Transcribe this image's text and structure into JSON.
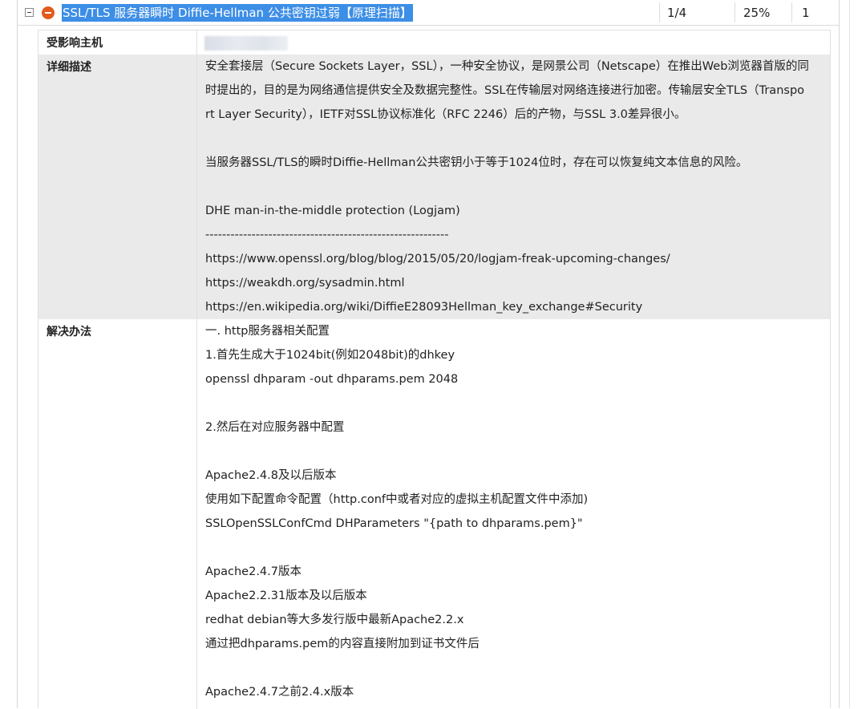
{
  "vuln": {
    "title": "SSL/TLS 服务器瞬时 Diffie-Hellman 公共密钥过弱【原理扫描】",
    "count": "1/4",
    "percent": "25%",
    "hosts": "1",
    "severity_icon": "minus-circle-icon",
    "severity_color": "#e25a1c",
    "selection_color": "#3d8ee6"
  },
  "labels": {
    "affected_host": "受影响主机",
    "description": "详细描述",
    "solution": "解决办法"
  },
  "description_lines": [
    "安全套接层（Secure Sockets Layer，SSL），一种安全协议，是网景公司（Netscape）在推出Web浏览器首版的同",
    "时提出的，目的是为网络通信提供安全及数据完整性。SSL在传输层对网络连接进行加密。传输层安全TLS（Transpo",
    "rt Layer Security），IETF对SSL协议标准化（RFC 2246）后的产物，与SSL 3.0差异很小。",
    "",
    "当服务器SSL/TLS的瞬时Diffie-Hellman公共密钥小于等于1024位时，存在可以恢复纯文本信息的风险。",
    "",
    "DHE man-in-the-middle protection (Logjam)",
    "----------------------------------------------------------",
    "https://www.openssl.org/blog/blog/2015/05/20/logjam-freak-upcoming-changes/",
    "https://weakdh.org/sysadmin.html",
    "https://en.wikipedia.org/wiki/DiffieE28093Hellman_key_exchange#Security"
  ],
  "solution_lines": [
    "一. http服务器相关配置",
    "1.首先生成大于1024bit(例如2048bit)的dhkey",
    "openssl dhparam -out dhparams.pem 2048",
    "",
    "2.然后在对应服务器中配置",
    "",
    "Apache2.4.8及以后版本",
    "使用如下配置命令配置（http.conf中或者对应的虚拟主机配置文件中添加)",
    "SSLOpenSSLConfCmd DHParameters \"{path to dhparams.pem}\"",
    "",
    "Apache2.4.7版本",
    "Apache2.2.31版本及以后版本",
    "redhat debian等大多发行版中最新Apache2.2.x",
    "通过把dhparams.pem的内容直接附加到证书文件后",
    "",
    "Apache2.4.7之前2.4.x版本"
  ]
}
